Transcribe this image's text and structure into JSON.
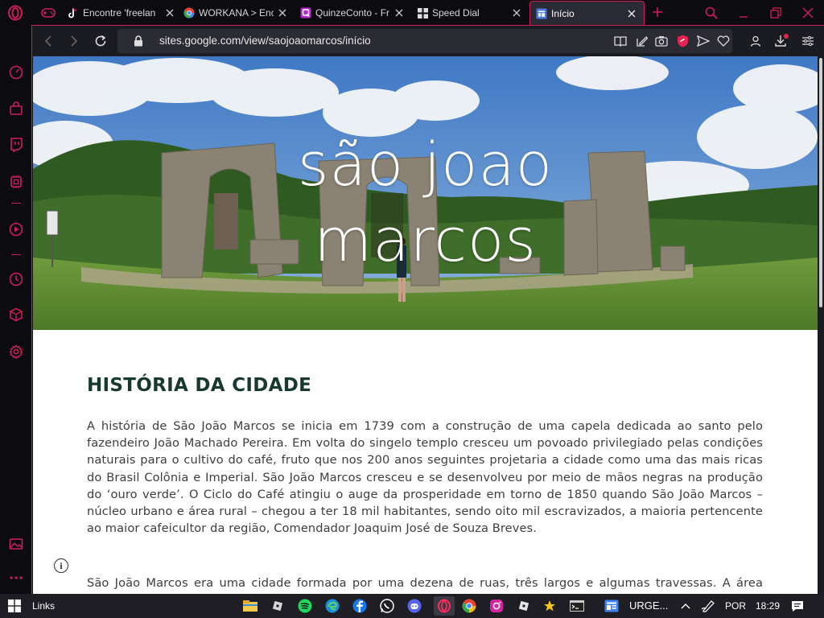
{
  "colors": {
    "accent": "#cc1f55",
    "heading": "#173a2c",
    "body_text": "#3d3d3d"
  },
  "tabs": [
    {
      "title": "Encontre 'freelan",
      "icon": "tiktok-icon"
    },
    {
      "title": "WORKANA > Enc",
      "icon": "chrome-style-icon"
    },
    {
      "title": "QuinzeConto - Fr",
      "icon": "quinzeconto-icon"
    },
    {
      "title": "Speed Dial",
      "icon": "speed-dial-icon"
    },
    {
      "title": "Início",
      "icon": "google-sites-icon"
    }
  ],
  "address": {
    "url": "sites.google.com/view/saojoaomarcos/início"
  },
  "hero": {
    "line1": "são joao",
    "line2": "marcos"
  },
  "content": {
    "heading": "HISTÓRIA DA CIDADE",
    "para1": "A história de São João Marcos se inicia em 1739 com a construção de uma capela dedicada ao santo pelo fazendeiro João Machado Pereira. Em volta do singelo templo cresceu um povoado privilegiado pelas condições naturais para o cultivo do café, fruto que nos 200 anos seguintes projetaria a cidade como uma das mais ricas do Brasil Colônia e Imperial. São João Marcos cresceu e se desenvolveu por meio de mãos negras na produção do ‘ouro verde’. O Ciclo do Café atingiu o auge da prosperidade em torno de 1850 quando São João Marcos – núcleo urbano e área rural – chegou a ter 18 mil habitantes, sendo oito mil escravizados, a maioria pertencente ao maior cafeicultor da região, Comendador Joaquim José de Souza Breves.",
    "para2": "São João Marcos era uma cidade formada por uma dezena de ruas, três largos e algumas travessas. A área urbana era",
    "info_icon": "i"
  },
  "taskbar": {
    "links_label": "Links",
    "urgent_label": "URGE...",
    "language": "POR",
    "time": "18:29"
  }
}
